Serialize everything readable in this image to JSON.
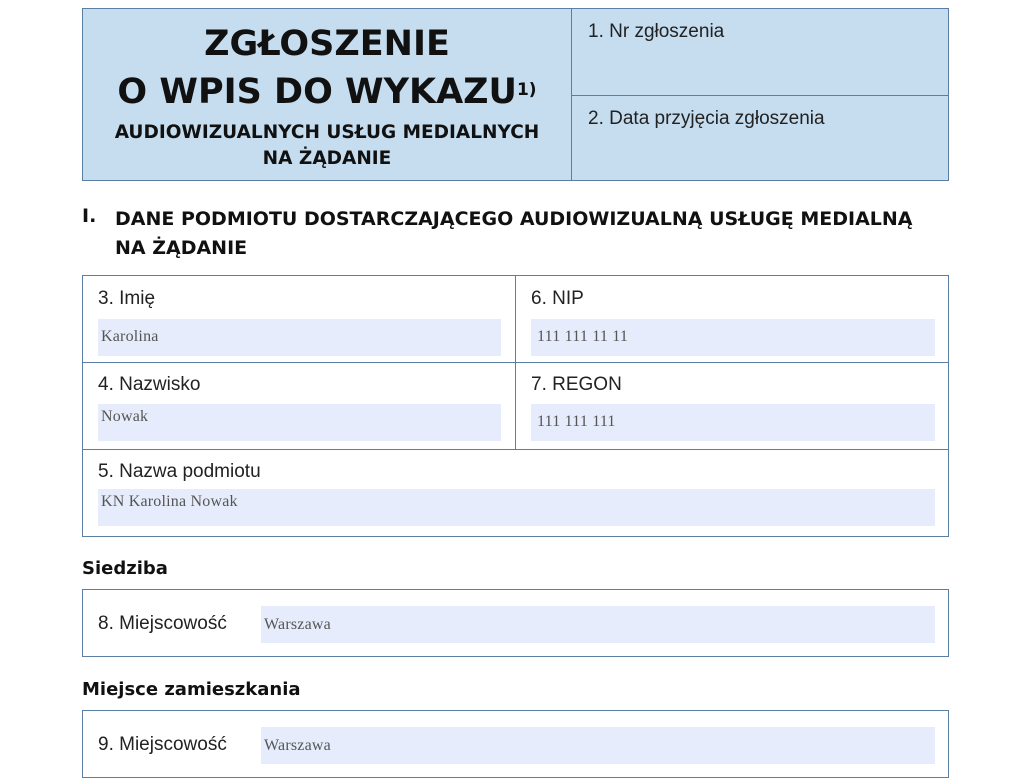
{
  "header": {
    "title_line1": "ZGŁOSZENIE",
    "title_line2": "O WPIS DO WYKAZU",
    "footnote": "1)",
    "subtitle_line1": "AUDIOWIZUALNYCH USŁUG MEDIALNYCH",
    "subtitle_line2": "NA ŻĄDANIE",
    "field1_label": "1. Nr zgłoszenia",
    "field2_label": "2. Data przyjęcia zgłoszenia"
  },
  "section1": {
    "number": "I.",
    "title_line1": "DANE PODMIOTU DOSTARCZAJĄCEGO AUDIOWIZUALNĄ USŁUGĘ MEDIALNĄ",
    "title_line2": "NA ŻĄDANIE",
    "imie_label": "3. Imię",
    "imie_value": "Karolina",
    "nip_label": "6. NIP",
    "nip_value": "111 111 11 11",
    "nazwisko_label": "4. Nazwisko",
    "nazwisko_value": "Nowak",
    "regon_label": "7. REGON",
    "regon_value": "111 111 111",
    "nazwa_label": "5. Nazwa podmiotu",
    "nazwa_value": "KN Karolina Nowak"
  },
  "siedziba": {
    "heading": "Siedziba",
    "miejscowosc_label": "8. Miejscowość",
    "miejscowosc_value": "Warszawa"
  },
  "zamieszkanie": {
    "heading": "Miejsce zamieszkania",
    "miejscowosc_label": "9. Miejscowość",
    "miejscowosc_value": "Warszawa"
  }
}
